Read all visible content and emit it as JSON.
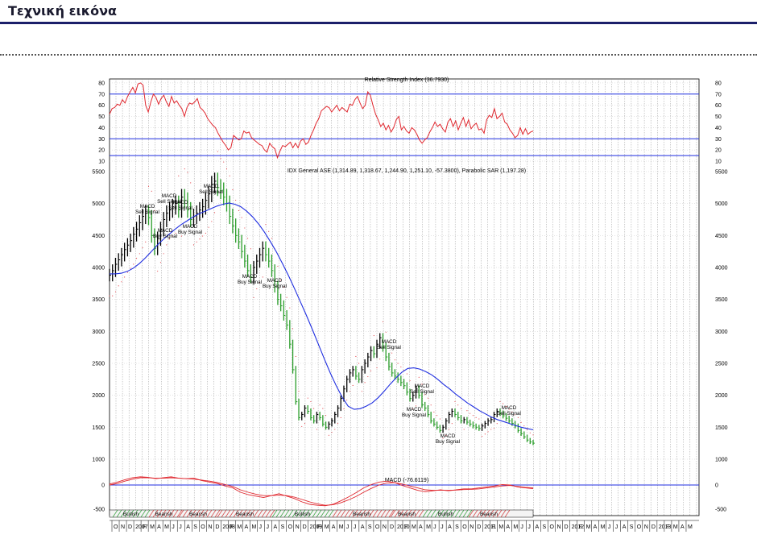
{
  "header": {
    "title": "Τεχνική εικόνα"
  },
  "chart_data": [
    {
      "type": "line",
      "title": "Relative Strength Index (36.7930)",
      "ylim": [
        10,
        80
      ],
      "yticks": [
        80,
        70,
        60,
        50,
        40,
        30,
        20,
        10
      ],
      "reference_lines": [
        70,
        30,
        15
      ],
      "series": [
        {
          "values": [
            52,
            57,
            58,
            61,
            60,
            65,
            62,
            68,
            72,
            76,
            71,
            79,
            80,
            78,
            60,
            54,
            63,
            70,
            67,
            61,
            66,
            69,
            63,
            59,
            68,
            62,
            64,
            60,
            57,
            50,
            58,
            62,
            61,
            63,
            66,
            58,
            56,
            53,
            48,
            45,
            42,
            40,
            35,
            31,
            27,
            24,
            20,
            22,
            33,
            31,
            29,
            30,
            37,
            35,
            36,
            31,
            29,
            27,
            25,
            24,
            20,
            18,
            26,
            23,
            21,
            13,
            19,
            24,
            23,
            25,
            27,
            22,
            26,
            22,
            28,
            30,
            25,
            27,
            33,
            38,
            44,
            48,
            55,
            57,
            59,
            58,
            54,
            57,
            60,
            55,
            58,
            56,
            54,
            61,
            60,
            65,
            68,
            62,
            57,
            60,
            72,
            69,
            60,
            52,
            47,
            41,
            44,
            38,
            42,
            36,
            40,
            47,
            50,
            38,
            41,
            37,
            35,
            40,
            38,
            34,
            29,
            26,
            29,
            31,
            36,
            40,
            45,
            41,
            43,
            39,
            36,
            45,
            48,
            41,
            46,
            38,
            44,
            49,
            41,
            47,
            39,
            42,
            44,
            38,
            39,
            35,
            47,
            51,
            49,
            57,
            48,
            50,
            53,
            45,
            43,
            38,
            35,
            31,
            33,
            40,
            34,
            39,
            34,
            36,
            37
          ]
        }
      ]
    },
    {
      "type": "line",
      "title": "IDX General ASE (1,314.89, 1,318.67, 1,244.90, 1,251.10, -57.3800), Parabolic SAR (1,197.28)",
      "ylim": [
        1000,
        5500
      ],
      "yticks": [
        5500,
        5000,
        4500,
        4000,
        3500,
        3000,
        2500,
        2000,
        1500,
        1000
      ],
      "series": [
        {
          "name": "IDX General ASE",
          "values": [
            3880,
            3950,
            4050,
            4120,
            4200,
            4280,
            4350,
            4420,
            4520,
            4600,
            4700,
            4800,
            4850,
            4780,
            4500,
            4300,
            4450,
            4600,
            4750,
            4850,
            4900,
            4950,
            5000,
            4900,
            5100,
            5050,
            4900,
            4750,
            4800,
            4850,
            4900,
            4950,
            5050,
            5150,
            5300,
            5350,
            5250,
            5200,
            5100,
            5000,
            4800,
            4650,
            4500,
            4400,
            4250,
            4100,
            3950,
            3850,
            4000,
            4100,
            4200,
            4300,
            4200,
            4100,
            3950,
            3700,
            3500,
            3400,
            3250,
            3100,
            2800,
            2400,
            1900,
            1650,
            1700,
            1800,
            1750,
            1650,
            1600,
            1700,
            1650,
            1550,
            1500,
            1550,
            1600,
            1700,
            1800,
            1950,
            2100,
            2250,
            2350,
            2400,
            2300,
            2250,
            2400,
            2500,
            2600,
            2700,
            2650,
            2800,
            2900,
            2750,
            2600,
            2450,
            2350,
            2300,
            2250,
            2200,
            2150,
            2050,
            1950,
            2000,
            2100,
            2000,
            1850,
            1800,
            1700,
            1600,
            1550,
            1500,
            1450,
            1500,
            1600,
            1700,
            1750,
            1700,
            1650,
            1600,
            1620,
            1580,
            1550,
            1520,
            1500,
            1480,
            1520,
            1560,
            1600,
            1620,
            1700,
            1750,
            1720,
            1680,
            1640,
            1600,
            1560,
            1520,
            1450,
            1400,
            1350,
            1300,
            1270,
            1251
          ]
        },
        {
          "name": "Moving Average",
          "values": [
            3900,
            3900,
            3910,
            3940,
            3990,
            4060,
            4150,
            4250,
            4350,
            4440,
            4520,
            4600,
            4670,
            4730,
            4790,
            4840,
            4880,
            4920,
            4960,
            4990,
            5010,
            4990,
            4950,
            4880,
            4790,
            4680,
            4550,
            4400,
            4240,
            4060,
            3870,
            3670,
            3460,
            3250,
            3030,
            2800,
            2570,
            2350,
            2150,
            1970,
            1830,
            1780,
            1790,
            1830,
            1880,
            1960,
            2060,
            2170,
            2270,
            2360,
            2420,
            2430,
            2410,
            2370,
            2320,
            2250,
            2170,
            2100,
            2020,
            1950,
            1880,
            1820,
            1760,
            1710,
            1660,
            1620,
            1590,
            1560,
            1530,
            1500,
            1480,
            1460
          ]
        }
      ]
    },
    {
      "type": "line",
      "title": "MACD (-76.6119)",
      "ylim": [
        -500,
        0
      ],
      "yticks": [
        0,
        -500
      ],
      "series": [
        {
          "values": [
            20,
            60,
            110,
            150,
            170,
            160,
            130,
            150,
            170,
            140,
            130,
            140,
            90,
            60,
            30,
            -20,
            -60,
            -150,
            -200,
            -230,
            -260,
            -220,
            -180,
            -230,
            -280,
            -350,
            -400,
            -420,
            -430,
            -400,
            -330,
            -250,
            -160,
            -60,
            10,
            60,
            80,
            50,
            -10,
            -60,
            -110,
            -140,
            -120,
            -100,
            -120,
            -100,
            -80,
            -80,
            -60,
            -40,
            -20,
            10,
            0,
            -40,
            -60,
            -77
          ]
        },
        {
          "values": [
            0,
            30,
            80,
            120,
            150,
            150,
            140,
            140,
            150,
            140,
            130,
            120,
            100,
            80,
            50,
            10,
            -30,
            -100,
            -150,
            -190,
            -220,
            -220,
            -210,
            -220,
            -250,
            -300,
            -350,
            -390,
            -420,
            -410,
            -370,
            -310,
            -240,
            -150,
            -70,
            0,
            40,
            50,
            20,
            -20,
            -60,
            -100,
            -110,
            -110,
            -110,
            -105,
            -95,
            -90,
            -80,
            -60,
            -40,
            -20,
            -10,
            -30,
            -50,
            -60
          ]
        }
      ]
    },
    {
      "type": "table",
      "bands": [
        "Bullish",
        "Bearish",
        "Bearish",
        "Bearish",
        "Bullish",
        "Bearish",
        "Bearish",
        "Bullish",
        "Bearish"
      ],
      "month_labels": [
        "O",
        "N",
        "D",
        "2007",
        "F",
        "M",
        "A",
        "M",
        "J",
        "J",
        "A",
        "S",
        "O",
        "N",
        "D",
        "2008",
        "F",
        "M",
        "A",
        "M",
        "J",
        "J",
        "A",
        "S",
        "O",
        "N",
        "D",
        "2009",
        "F",
        "M",
        "A",
        "M",
        "J",
        "J",
        "A",
        "S",
        "O",
        "N",
        "D",
        "2010",
        "F",
        "M",
        "A",
        "M",
        "J",
        "J",
        "A",
        "S",
        "O",
        "N",
        "D",
        "2011",
        "F",
        "M",
        "A",
        "M",
        "J",
        "J",
        "A",
        "S",
        "O",
        "N",
        "D",
        "2012",
        "F",
        "M",
        "A",
        "M",
        "J",
        "J",
        "A",
        "S",
        "O",
        "N",
        "D",
        "2013",
        "F",
        "M",
        "A",
        "M"
      ]
    }
  ],
  "annotations": [
    {
      "text": "MACD Sell Signal"
    },
    {
      "text": "MACD Sell Signal"
    },
    {
      "text": "MACD Sell Signal"
    },
    {
      "text": "MACD Sell Signal"
    },
    {
      "text": "MACD Buy Signal"
    },
    {
      "text": "MACD Buy Signal"
    },
    {
      "text": "MACD Buy Signal"
    },
    {
      "text": "MACD Buy Signal"
    },
    {
      "text": "MACD Sell Signal"
    },
    {
      "text": "MACD Sell Signal"
    },
    {
      "text": "MACD Buy Signal"
    },
    {
      "text": "MACD Buy Signal"
    },
    {
      "text": "MACD Sell Signal"
    }
  ],
  "colors": {
    "rsi": "#e0282f",
    "ma": "#1f2ee0",
    "sar": "#e0282f",
    "hline": "#1f2ee0",
    "zero": "#1f2ee0",
    "title_rule": "#1b1f6a",
    "up_bar": "#000000",
    "down_bar": "#2a9d2a"
  }
}
